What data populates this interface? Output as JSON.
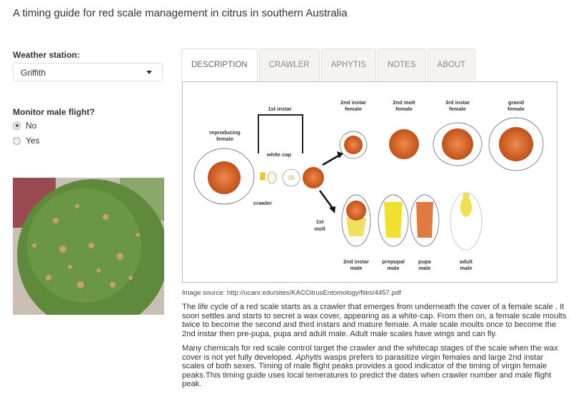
{
  "page_title": "A timing guide for red scale management in citrus in southern Australia",
  "sidebar": {
    "station_label": "Weather station:",
    "station_value": "Griffith",
    "flight_label": "Monitor male flight?",
    "options": [
      {
        "label": "No",
        "selected": true
      },
      {
        "label": "Yes",
        "selected": false
      }
    ]
  },
  "tabs": [
    {
      "label": "DESCRIPTION",
      "active": true
    },
    {
      "label": "CRAWLER"
    },
    {
      "label": "APHYTIS"
    },
    {
      "label": "NOTES"
    },
    {
      "label": "ABOUT"
    }
  ],
  "diagram": {
    "reproducing": [
      "reproducing",
      "female"
    ],
    "first_instar": "1st instar",
    "white_cap": "white cap",
    "crawler": "crawler",
    "f2": [
      "2nd instar",
      "female"
    ],
    "f2m": [
      "2nd molt",
      "female"
    ],
    "f3": [
      "3rd instar",
      "female"
    ],
    "fg": [
      "gravid",
      "female"
    ],
    "molt": [
      "1st",
      "molt"
    ],
    "m2": [
      "2nd instar",
      "male"
    ],
    "mp": [
      "prepupal",
      "male"
    ],
    "mpu": [
      "pupa",
      "male"
    ],
    "ma": [
      "adult",
      "male"
    ]
  },
  "image_source": "Image source: http://ucanr.edu/sites/KACCitrusEntomology/files/4457.pdf",
  "para1": "The life cycle of a red scale starts as a crawler that emerges from underneath the cover of a female scale . It soon settles and starts to secret a wax cover, appearing as a white-cap. From then on, a female scale moults twice to become the second and third instars and mature female. A male scale moults once to become the 2nd instar then pre-pupa, pupa and adult male. Adult male scales have wings and can fly.",
  "para2": {
    "before": "Many chemicals for red scale control target the crawler and the whitecap stages of the scale when the wax cover is not yet fully developed. ",
    "italic": "Aphytis",
    "after": " wasps prefers to parasitize virgin females and large 2nd instar scales of both sexes. Timing of male flight peaks provides a good indicator of the timing of virgin female peaks.This timing guide uses local temeratures to predict the dates when crawler number and male flight peak."
  }
}
